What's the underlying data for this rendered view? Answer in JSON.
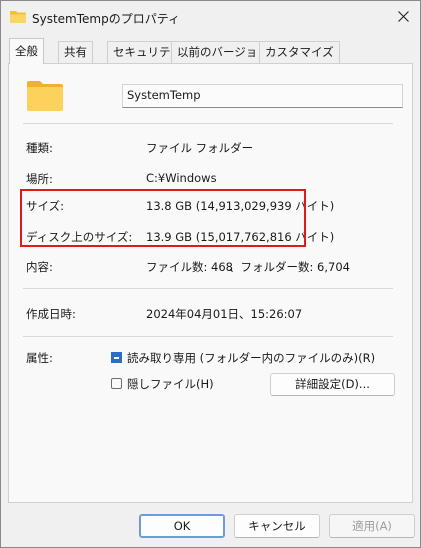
{
  "window": {
    "title": "SystemTempのプロパティ"
  },
  "tabs": [
    "全般",
    "共有",
    "セキュリティ",
    "以前のバージョン",
    "カスタマイズ"
  ],
  "name_field": {
    "value": "SystemTemp"
  },
  "props": {
    "type_label": "種類:",
    "type_value": "ファイル フォルダー",
    "location_label": "場所:",
    "location_value": "C:¥Windows",
    "size_label": "サイズ:",
    "size_value": "13.8 GB (14,913,029,939 バイト)",
    "disk_size_label": "ディスク上のサイズ:",
    "disk_size_value": "13.9 GB (15,017,762,816 バイト)",
    "contents_label": "内容:",
    "contents_files": "ファイル数: 468",
    "contents_folders": "、フォルダー数: 6,704",
    "created_label": "作成日時:",
    "created_value": "2024年04月01日、15:26:07"
  },
  "attributes": {
    "label": "属性:",
    "readonly_label": "読み取り専用 (フォルダー内のファイルのみ)(R)",
    "readonly_state": "indeterminate",
    "hidden_label": "隠しファイル(H)",
    "hidden_state": "unchecked",
    "advanced_button": "詳細設定(D)..."
  },
  "buttons": {
    "ok": "OK",
    "cancel": "キャンセル",
    "apply": "適用(A)"
  },
  "colors": {
    "highlight_border": "#e01a1a",
    "checkbox_accent": "#2a6fc4",
    "folder": "#f6c94a"
  }
}
